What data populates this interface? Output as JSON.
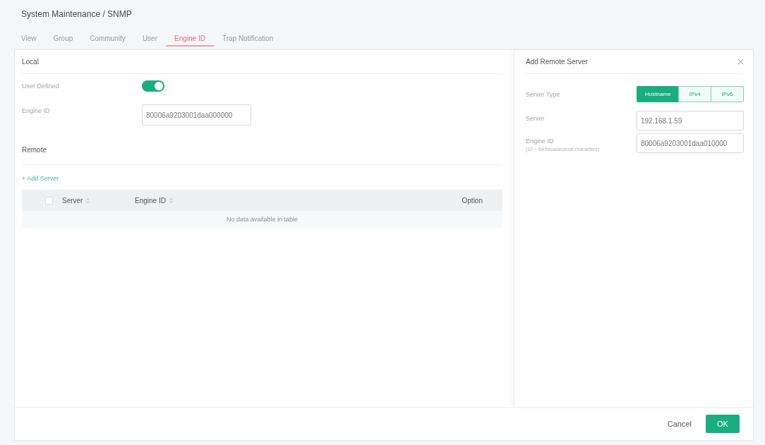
{
  "breadcrumb": "System Maintenance / SNMP",
  "tabs": [
    {
      "label": "View",
      "selected": false
    },
    {
      "label": "Group",
      "selected": false
    },
    {
      "label": "Community",
      "selected": false
    },
    {
      "label": "User",
      "selected": false
    },
    {
      "label": "Engine ID",
      "selected": true
    },
    {
      "label": "Trap Notification",
      "selected": false
    }
  ],
  "local": {
    "title": "Local",
    "fields": [
      {
        "kind": "toggle",
        "label": "User Defined",
        "on": true
      },
      {
        "kind": "input",
        "label": "Engine ID",
        "value": "80006a9203001daa000000"
      }
    ]
  },
  "remote": {
    "title": "Remote",
    "add_link": "+ Add Server",
    "table": {
      "select_all": {
        "checked": false
      },
      "columns": [
        {
          "label": "Server",
          "sortable": true
        },
        {
          "label": "Engine ID",
          "sortable": true
        },
        {
          "label": "Option",
          "sortable": false
        }
      ],
      "empty_message": "No data available in table"
    }
  },
  "dialog": {
    "title": "Add Remote Server",
    "fields": [
      {
        "kind": "segmented",
        "label": "Server Type",
        "options": [
          {
            "label": "Hostname",
            "selected": true
          },
          {
            "label": "IPv4",
            "selected": false
          },
          {
            "label": "IPv6",
            "selected": false
          }
        ]
      },
      {
        "kind": "input",
        "label": "Server",
        "value": "192.168.1.59"
      },
      {
        "kind": "input",
        "label": "Engine ID",
        "hint": "(10 ~ 64 hexadecimal characters)",
        "value": "80006a9203001daa010000"
      }
    ]
  },
  "footer": {
    "buttons": [
      {
        "kind": "text",
        "label": "Cancel"
      },
      {
        "kind": "primary",
        "label": "OK"
      }
    ]
  }
}
